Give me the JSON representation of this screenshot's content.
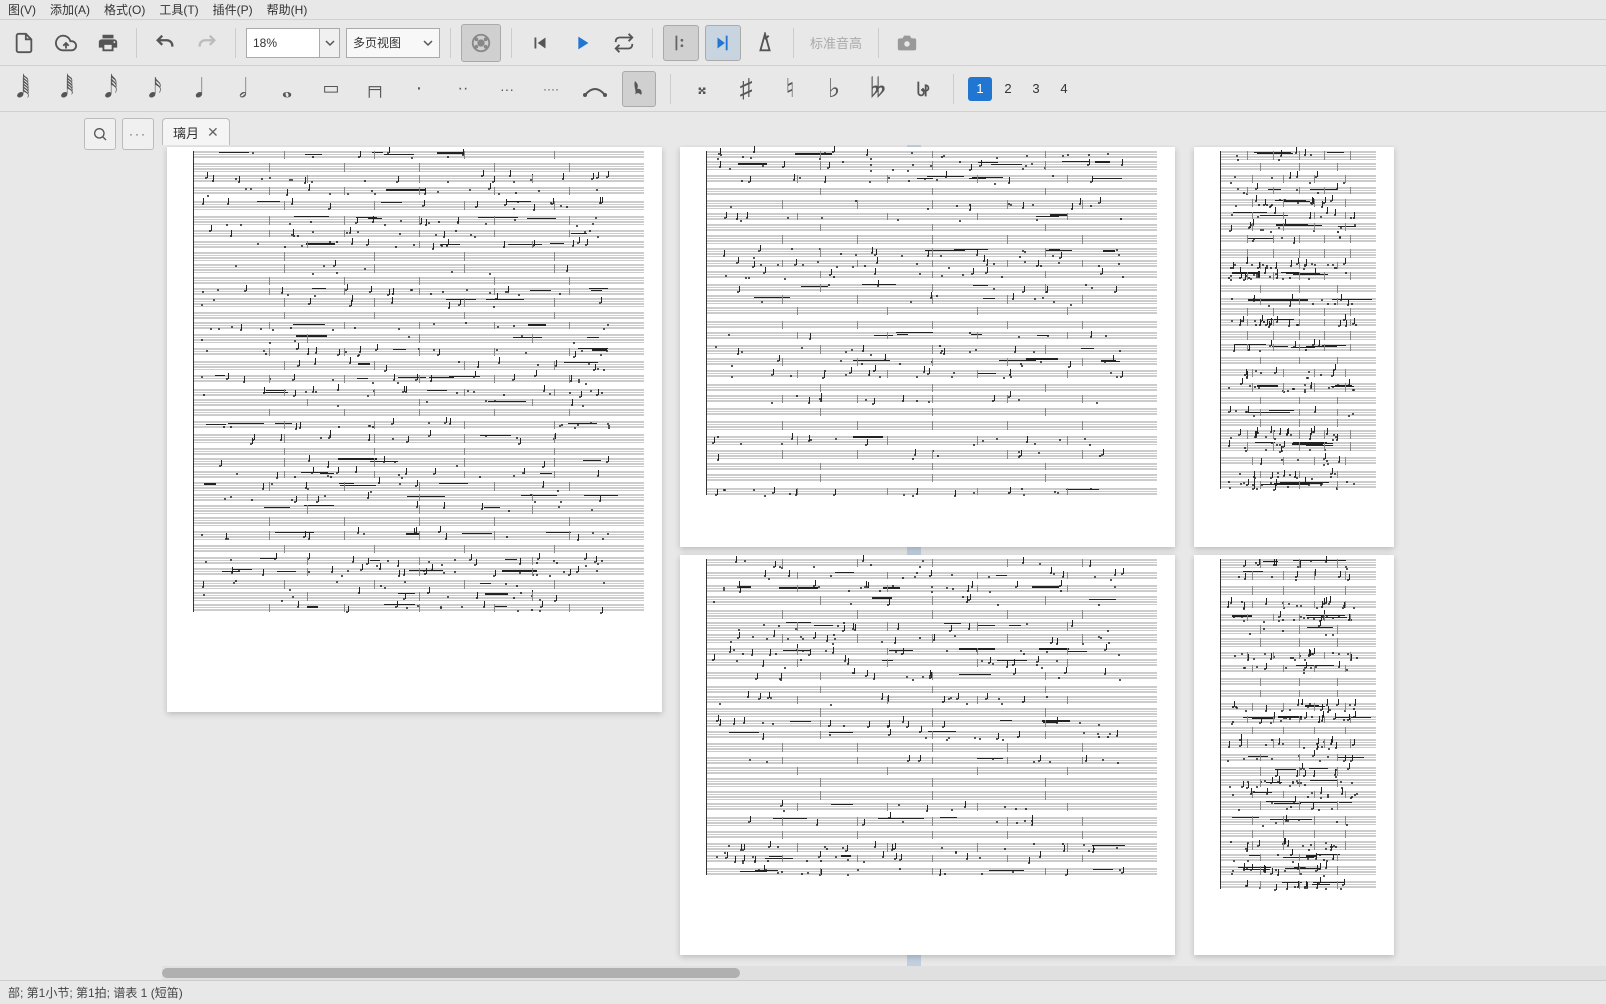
{
  "menu": {
    "items": [
      "图(V)",
      "添加(A)",
      "格式(O)",
      "工具(T)",
      "插件(P)",
      "帮助(H)"
    ]
  },
  "toolbar": {
    "zoom_value": "18%",
    "view_mode": "多页视图",
    "pitch_label": "标准音高"
  },
  "voices": [
    "1",
    "2",
    "3",
    "4"
  ],
  "tab": {
    "title": "璃月"
  },
  "sidepanel": {
    "expand_icon": "⛶",
    "close_icon": "✕"
  },
  "statusbar": {
    "text": "部; 第1小节; 第1拍; 谱表 1 (短笛)"
  },
  "accidentals": {
    "double_sharp": "𝄪",
    "sharp": "♯",
    "natural": "♮",
    "flat": "♭",
    "double_flat": "𝄫"
  },
  "note_durations": {
    "n64": "𝅘𝅥𝅲",
    "n32": "𝅘𝅥𝅱",
    "n16": "𝅘𝅥𝅰",
    "n8": "𝅘𝅥𝅯",
    "n4": "𝅘𝅥",
    "n2": "𝅗𝅥",
    "n1": "𝅝",
    "dot1": "·",
    "dot2": "··",
    "dot3": "···",
    "dot4": "····"
  }
}
